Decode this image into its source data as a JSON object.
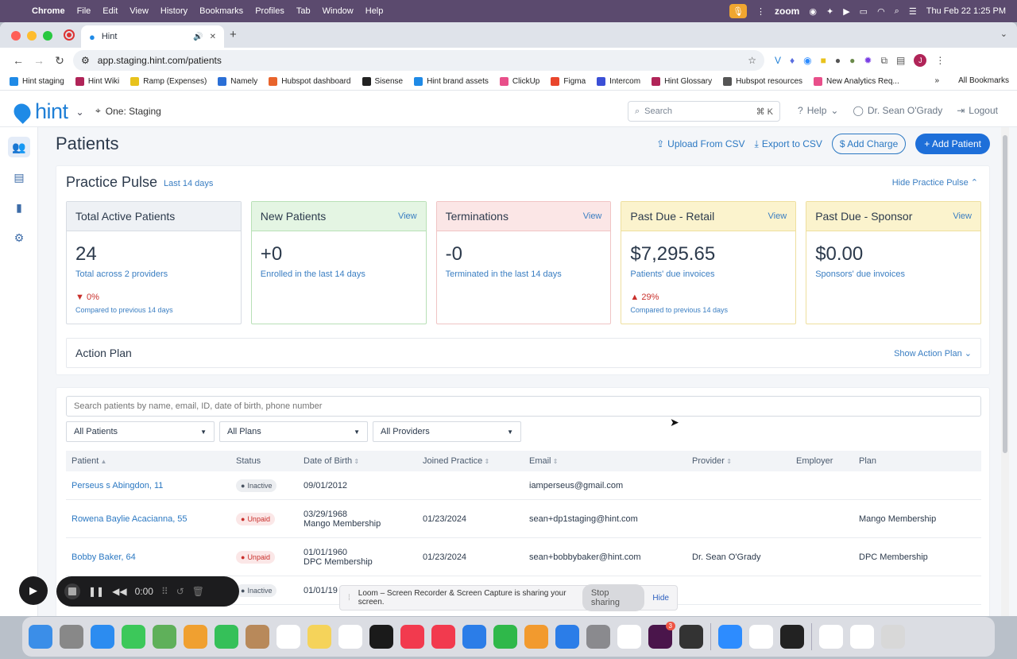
{
  "menubar": {
    "app": "Chrome",
    "items": [
      "File",
      "Edit",
      "View",
      "History",
      "Bookmarks",
      "Profiles",
      "Tab",
      "Window",
      "Help"
    ],
    "zoom_label": "zoom",
    "datetime": "Thu Feb 22  1:25 PM"
  },
  "browser": {
    "tab_title": "Hint",
    "url": "app.staging.hint.com/patients",
    "bookmarks": [
      "Hint staging",
      "Hint Wiki",
      "Ramp (Expenses)",
      "Namely",
      "Hubspot dashboard",
      "Sisense",
      "Hint brand assets",
      "ClickUp",
      "Figma",
      "Intercom",
      "Hint Glossary",
      "Hubspot resources",
      "New Analytics Req..."
    ],
    "bookmark_colors": [
      "#1f8ae6",
      "#b02458",
      "#e8c21c",
      "#2b6fd6",
      "#e8642c",
      "#222222",
      "#1f8ae6",
      "#e84f8a",
      "#e9462c",
      "#3b4fd6",
      "#b02458",
      "#555555",
      "#e84f8a"
    ],
    "all_bookmarks": "All Bookmarks"
  },
  "header": {
    "logo": "hint",
    "location": "One: Staging",
    "search_placeholder": "Search",
    "search_shortcut": "⌘ K",
    "help": "Help",
    "user": "Dr. Sean O'Grady",
    "logout": "Logout"
  },
  "page": {
    "title": "Patients",
    "upload": "Upload From CSV",
    "export": "Export to CSV",
    "add_charge": "$ Add Charge",
    "add_patient": "Add Patient"
  },
  "pulse": {
    "title": "Practice Pulse",
    "range": "Last 14 days",
    "hide": "Hide Practice Pulse",
    "cards": [
      {
        "title": "Total Active Patients",
        "view": "",
        "value": "24",
        "desc": "Total across 2 providers",
        "trend": "0%",
        "compare": "Compared to previous 14 days"
      },
      {
        "title": "New Patients",
        "view": "View",
        "value": "+0",
        "desc": "Enrolled in the last 14 days",
        "trend": "",
        "compare": ""
      },
      {
        "title": "Terminations",
        "view": "View",
        "value": "-0",
        "desc": "Terminated in the last 14 days",
        "trend": "",
        "compare": ""
      },
      {
        "title": "Past Due - Retail",
        "view": "View",
        "value": "$7,295.65",
        "desc": "Patients' due invoices",
        "trend": "29%",
        "compare": "Compared to previous 14 days"
      },
      {
        "title": "Past Due - Sponsor",
        "view": "View",
        "value": "$0.00",
        "desc": "Sponsors' due invoices",
        "trend": "",
        "compare": ""
      }
    ]
  },
  "action_plan": {
    "title": "Action Plan",
    "show": "Show Action Plan"
  },
  "patients": {
    "search_placeholder": "Search patients by name, email, ID, date of birth, phone number",
    "filters": [
      "All Patients",
      "All Plans",
      "All Providers"
    ],
    "columns": [
      "Patient",
      "Status",
      "Date of Birth",
      "Joined Practice",
      "Email",
      "Provider",
      "Employer",
      "Plan"
    ],
    "rows": [
      {
        "name": "Perseus s Abingdon, 11",
        "status": "Inactive",
        "dob": "09/01/2012",
        "dob_sub": "",
        "joined": "",
        "email": "iamperseus@gmail.com",
        "provider": "",
        "employer": "",
        "plan": ""
      },
      {
        "name": "Rowena Baylie Acacianna, 55",
        "status": "Unpaid",
        "dob": "03/29/1968",
        "dob_sub": "Mango Membership",
        "joined": "01/23/2024",
        "email": "sean+dp1staging@hint.com",
        "provider": "",
        "employer": "",
        "plan": "Mango Membership"
      },
      {
        "name": "Bobby Baker, 64",
        "status": "Unpaid",
        "dob": "01/01/1960",
        "dob_sub": "DPC Membership",
        "joined": "01/23/2024",
        "email": "sean+bobbybaker@hint.com",
        "provider": "Dr. Sean O'Grady",
        "employer": "",
        "plan": "DPC Membership"
      },
      {
        "name": "",
        "status": "Inactive",
        "dob": "01/01/19",
        "dob_sub": "",
        "joined": "",
        "email": "",
        "provider": "",
        "employer": "",
        "plan": ""
      }
    ]
  },
  "loom": {
    "timer": "0:00",
    "share_text": "Loom – Screen Recorder & Screen Capture is sharing your screen.",
    "stop": "Stop sharing",
    "hide": "Hide"
  },
  "dock": {
    "apps": [
      "finder",
      "launchpad",
      "safari",
      "messages",
      "maps",
      "photos",
      "facetime",
      "contacts",
      "reminders",
      "notes",
      "freeform",
      "tv",
      "music",
      "news",
      "keynote",
      "numbers",
      "pages",
      "app-store",
      "system-settings",
      "chrome",
      "slack",
      "calculator",
      "zoom",
      "preview",
      "terminal",
      "downloads",
      "documents",
      "trash"
    ],
    "colors": [
      "#3b8ee8",
      "#888888",
      "#2c8cf0",
      "#3cc85a",
      "#5fb05a",
      "#f0a030",
      "#35c059",
      "#b8895a",
      "#ffffff",
      "#f5d35a",
      "#ffffff",
      "#1a1a1a",
      "#f23a4e",
      "#f23a4e",
      "#2b7de8",
      "#2fb84a",
      "#f29a2e",
      "#2b7de8",
      "#8a8a8e",
      "#ffffff",
      "#4a154b",
      "#333333",
      "#2d8cff",
      "#ffffff",
      "#222222",
      "#ffffff",
      "#ffffff",
      "#d8d8d8"
    ],
    "slack_badge": "3"
  }
}
